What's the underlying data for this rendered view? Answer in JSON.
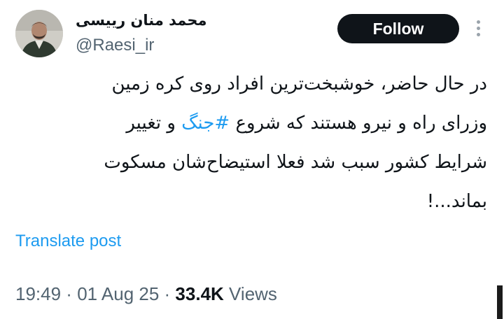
{
  "user": {
    "display_name": "محمد منان رییسی",
    "handle": "@Raesi_ir",
    "avatar_icon": "profile-photo"
  },
  "follow_label": "Follow",
  "more_icon": "more-vertical-icon",
  "tweet": {
    "line1": "در حال حاضر، خوشبخت‌ترین افراد روی کره زمین",
    "line2_before": "وزرای راه و نیرو هستند که شروع ",
    "hashtag": "#جنگ",
    "line2_after": " و تغییر",
    "line3": "شرایط کشور سبب شد فعلا استیضاح‌شان مسکوت",
    "line4": "بماند...!"
  },
  "translate_label": "Translate post",
  "meta": {
    "time": "19:49",
    "date": "01 Aug 25",
    "separator": " · ",
    "views_count": "33.4K",
    "views_label": "Views"
  },
  "colors": {
    "accent": "#1d9bf0",
    "text_primary": "#0f1419",
    "text_secondary": "#536471",
    "button_bg": "#0f1419"
  }
}
